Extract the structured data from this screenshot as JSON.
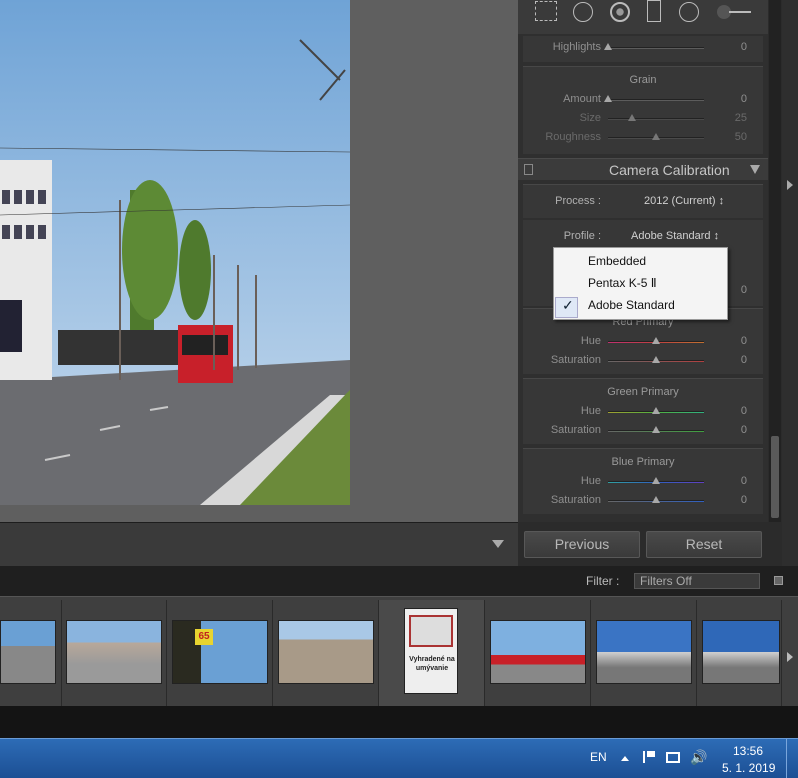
{
  "panel": {
    "highlights": {
      "label": "Highlights",
      "value": "0"
    },
    "grain": {
      "title": "Grain",
      "amount": {
        "label": "Amount",
        "value": "0"
      },
      "size": {
        "label": "Size",
        "value": "25"
      },
      "roughness": {
        "label": "Roughness",
        "value": "50"
      }
    },
    "calibration": {
      "title": "Camera Calibration",
      "process_label": "Process :",
      "process_value": "2012 (Current) ↕",
      "profile_label": "Profile :",
      "profile_value": "Adobe Standard ↕",
      "shadows_value": "0"
    },
    "red": {
      "title": "Red Primary",
      "hue": {
        "label": "Hue",
        "value": "0"
      },
      "sat": {
        "label": "Saturation",
        "value": "0"
      }
    },
    "green": {
      "title": "Green Primary",
      "hue": {
        "label": "Hue",
        "value": "0"
      },
      "sat": {
        "label": "Saturation",
        "value": "0"
      }
    },
    "blue": {
      "title": "Blue Primary",
      "hue": {
        "label": "Hue",
        "value": "0"
      },
      "sat": {
        "label": "Saturation",
        "value": "0"
      }
    },
    "previous_label": "Previous",
    "reset_label": "Reset"
  },
  "menu": {
    "items": [
      "Embedded",
      "Pentax K-5 Ⅱ",
      "Adobe Standard"
    ],
    "checked": "✓"
  },
  "filter": {
    "label": "Filter :",
    "value": "Filters Off"
  },
  "thumbs": {
    "sign_top": "65",
    "thumb5_text": "Vyhradené na umývanie"
  },
  "taskbar": {
    "lang": "EN",
    "time": "13:56",
    "date": "5. 1. 2019"
  },
  "colors": {
    "panel_bg": "#2f2f2f",
    "taskbar": "#1f5aa6"
  }
}
